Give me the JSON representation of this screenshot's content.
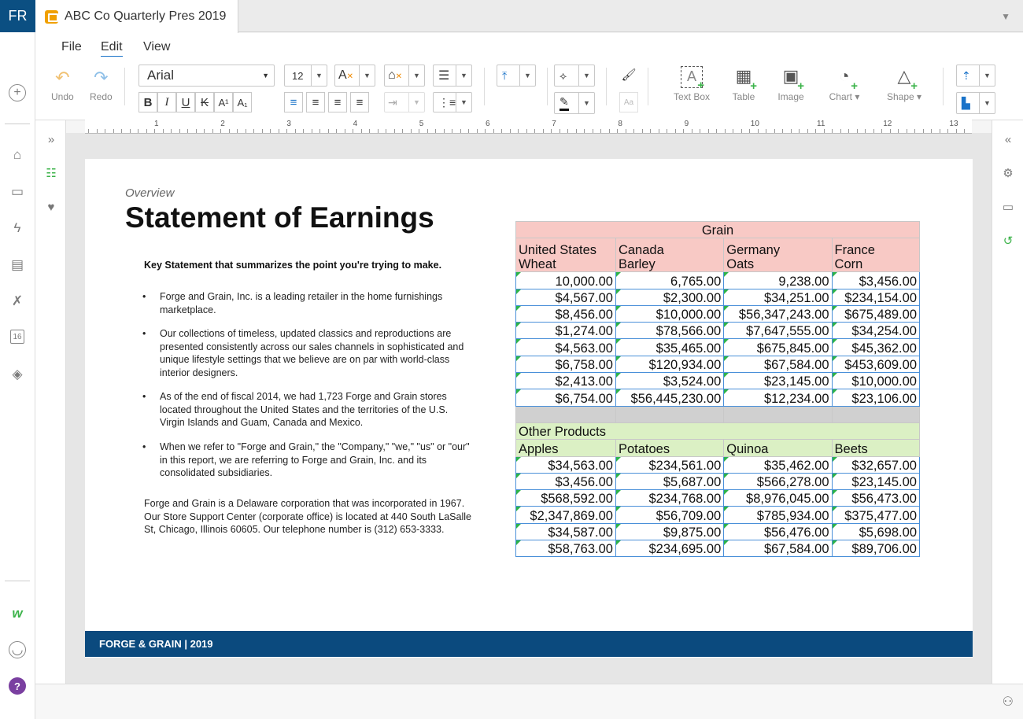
{
  "app": {
    "badge": "FR"
  },
  "tab": {
    "title": "ABC Co Quarterly Pres 2019"
  },
  "menu": {
    "file": "File",
    "edit": "Edit",
    "view": "View"
  },
  "toolbar": {
    "undo": "Undo",
    "redo": "Redo",
    "font": "Arial",
    "size": "12",
    "insert": {
      "textbox": "Text Box",
      "table": "Table",
      "image": "Image",
      "chart": "Chart",
      "shape": "Shape"
    }
  },
  "ruler": [
    "1",
    "2",
    "3",
    "4",
    "5",
    "6",
    "7",
    "8",
    "9",
    "10",
    "11",
    "12",
    "13"
  ],
  "slide": {
    "overview": "Overview",
    "title": "Statement of Earnings",
    "key": "Key Statement that summarizes the point you're trying to make.",
    "bullets": [
      "Forge and Grain, Inc. is a leading retailer in the home furnishings marketplace.",
      "Our collections of timeless, updated classics and reproductions are presented consistently across our sales channels in sophisticated and unique lifestyle settings that we believe are on par with world-class interior designers.",
      " As of the end of fiscal 2014, we had 1,723 Forge and Grain stores located throughout the United States and the territories of the U.S. Virgin Islands and Guam, Canada and Mexico.",
      "When we refer to \"Forge and Grain,\" the \"Company,\" \"we,\" \"us\" or \"our\" in this report, we are referring to Forge and Grain, Inc. and its consolidated subsidiaries."
    ],
    "paragraph": "Forge and Grain is a Delaware corporation that was incorporated in 1967. Our Store Support Center (corporate office) is located at 440 South LaSalle St, Chicago, Illinois 60605. Our telephone number is (312) 653-3333.",
    "footer": "FORGE & GRAIN  |  2019"
  },
  "table": {
    "grain": {
      "title": "Grain",
      "headers": [
        [
          "United States",
          "Wheat"
        ],
        [
          "Canada",
          "Barley"
        ],
        [
          "Germany",
          "Oats"
        ],
        [
          "France",
          "Corn"
        ]
      ],
      "rows": [
        [
          "10,000.00",
          "6,765.00",
          "9,238.00",
          "$3,456.00"
        ],
        [
          "$4,567.00",
          "$2,300.00",
          "$34,251.00",
          "$234,154.00"
        ],
        [
          "$8,456.00",
          "$10,000.00",
          "$56,347,243.00",
          "$675,489.00"
        ],
        [
          "$1,274.00",
          "$78,566.00",
          "$7,647,555.00",
          "$34,254.00"
        ],
        [
          "$4,563.00",
          "$35,465.00",
          "$675,845.00",
          "$45,362.00"
        ],
        [
          "$6,758.00",
          "$120,934.00",
          "$67,584.00",
          "$453,609.00"
        ],
        [
          "$2,413.00",
          "$3,524.00",
          "$23,145.00",
          "$10,000.00"
        ],
        [
          "$6,754.00",
          "$56,445,230.00",
          "$12,234.00",
          "$23,106.00"
        ]
      ]
    },
    "other": {
      "title": "Other Products",
      "headers": [
        "Apples",
        "Potatoes",
        "Quinoa",
        "Beets"
      ],
      "rows": [
        [
          "$34,563.00",
          "$234,561.00",
          "$35,462.00",
          "$32,657.00"
        ],
        [
          "$3,456.00",
          "$5,687.00",
          "$566,278.00",
          "$23,145.00"
        ],
        [
          "$568,592.00",
          "$234,768.00",
          "$8,976,045.00",
          "$56,473.00"
        ],
        [
          "$2,347,869.00",
          "$56,709.00",
          "$785,934.00",
          "$375,477.00"
        ],
        [
          "$34,587.00",
          "$9,875.00",
          "$56,476.00",
          "$5,698.00"
        ],
        [
          "$58,763.00",
          "$234,695.00",
          "$67,584.00",
          "$89,706.00"
        ]
      ]
    }
  }
}
